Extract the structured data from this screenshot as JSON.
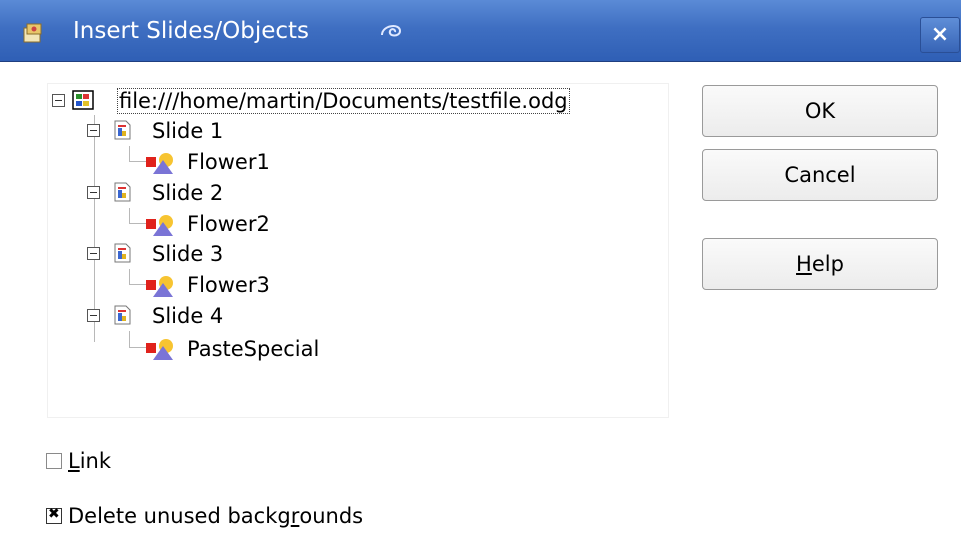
{
  "window": {
    "title": "Insert Slides/Objects",
    "close_label": "×"
  },
  "tree": {
    "root": "file:///home/martin/Documents/testfile.odg",
    "slides": [
      {
        "label": "Slide 1",
        "object": "Flower1"
      },
      {
        "label": "Slide 2",
        "object": "Flower2"
      },
      {
        "label": "Slide 3",
        "object": "Flower3"
      },
      {
        "label": "Slide 4",
        "object": "PasteSpecial"
      }
    ]
  },
  "buttons": {
    "ok": "OK",
    "cancel": "Cancel",
    "help_prefix": "H",
    "help_rest": "elp"
  },
  "options": {
    "link_prefix": "L",
    "link_rest": "ink",
    "link_checked": false,
    "delete_bg_part1": "Delete unused backg",
    "delete_bg_ul": "r",
    "delete_bg_part2": "ounds",
    "delete_bg_checked": true
  },
  "colors": {
    "titlebar": "#3f6fc2",
    "title_text": "#ffffff"
  }
}
